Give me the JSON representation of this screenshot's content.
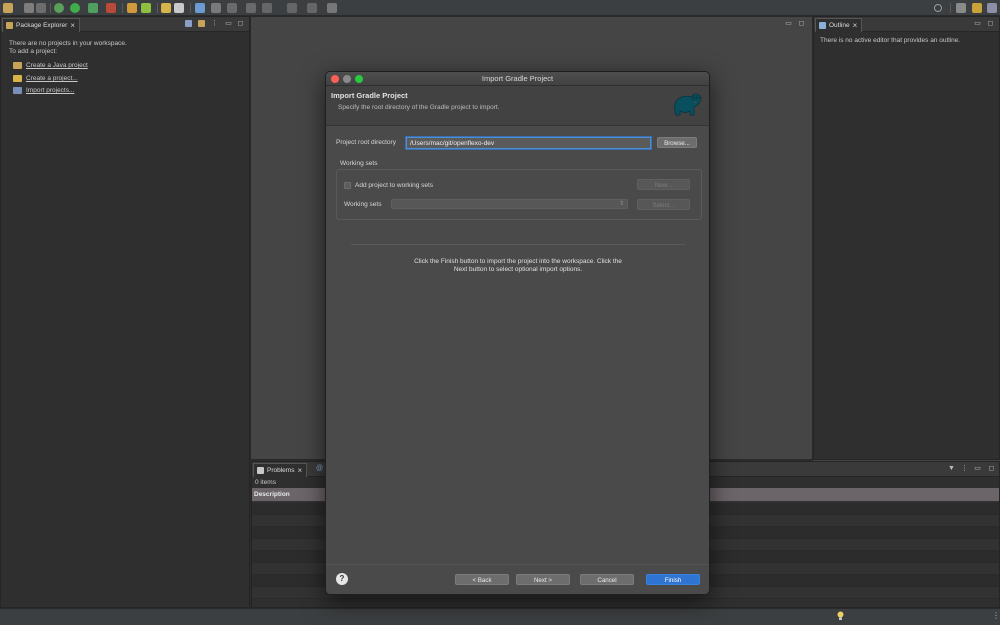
{
  "package_explorer": {
    "tab_label": "Package Explorer",
    "message_line1": "There are no projects in your workspace.",
    "message_line2": "To add a project:",
    "links": [
      "Create a Java project",
      "Create a project...",
      "Import projects..."
    ]
  },
  "outline": {
    "tab_label": "Outline",
    "message": "There is no active editor that provides an outline."
  },
  "problems": {
    "tab_label": "Problems",
    "count": "0 items",
    "column_description": "Description"
  },
  "dialog": {
    "window_title": "Import Gradle Project",
    "title": "Import Gradle Project",
    "subtitle": "Specify the root directory of the Gradle project to import.",
    "root_dir_label": "Project root directory",
    "root_dir_value": "/Users/mac/git/openflexo-dev",
    "browse_button": "Browse...",
    "working_sets_group": "Working sets",
    "add_to_working_sets": "Add project to working sets",
    "new_button": "New...",
    "working_sets_label": "Working sets",
    "select_button": "Select...",
    "info_line1": "Click the Finish button to import the project into the workspace. Click the",
    "info_line2": "Next button to select optional import options.",
    "back_button": "< Back",
    "next_button": "Next >",
    "cancel_button": "Cancel",
    "finish_button": "Finish"
  },
  "colors": {
    "accent_blue": "#2f74d0",
    "gradle_teal": "#02303a",
    "traffic_close": "#fe5f57",
    "traffic_min": "#febc2e",
    "traffic_max": "#28c840"
  }
}
